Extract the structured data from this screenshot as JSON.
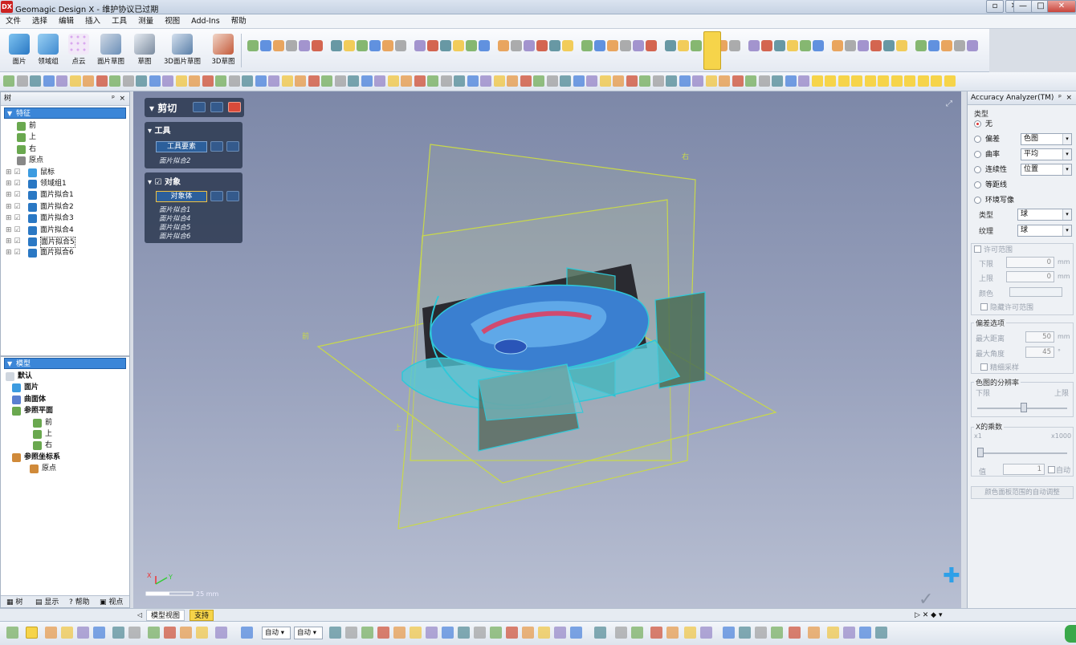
{
  "app": {
    "logo": "DX",
    "title": "Geomagic Design X - 维护协议已过期"
  },
  "window": {
    "minimize": "—",
    "maximize": "□",
    "close": "✕",
    "restore_small": "▫",
    "close_small": "✕"
  },
  "menu": [
    "文件",
    "选择",
    "编辑",
    "插入",
    "工具",
    "测量",
    "视图",
    "Add-Ins",
    "帮助"
  ],
  "ribbon": {
    "buttons": [
      {
        "label": "面片",
        "color": "#3a8fd6"
      },
      {
        "label": "领域组",
        "color": "#4a9ad8"
      },
      {
        "label": "点云",
        "color": "#b27ad0"
      },
      {
        "label": "面片草图",
        "color": "#6b8fb8"
      },
      {
        "label": "草图",
        "color": "#7a8a9e"
      },
      {
        "label": "3D面片草图",
        "color": "#5a7fa8"
      },
      {
        "label": "3D草图",
        "color": "#c45a3a"
      }
    ]
  },
  "tree_panel": {
    "header": "树",
    "pin": "ᵖ",
    "close": "×",
    "section": "特征",
    "items": [
      {
        "label": "前",
        "indent": 1
      },
      {
        "label": "上",
        "indent": 1
      },
      {
        "label": "右",
        "indent": 1
      },
      {
        "label": "原点",
        "indent": 1
      },
      {
        "label": "鼠标",
        "indent": 2
      },
      {
        "label": "领域组1",
        "indent": 2
      },
      {
        "label": "面片拟合1",
        "indent": 2
      },
      {
        "label": "面片拟合2",
        "indent": 2
      },
      {
        "label": "面片拟合3",
        "indent": 2
      },
      {
        "label": "面片拟合4",
        "indent": 2
      },
      {
        "label": "面片拟合5",
        "indent": 2
      },
      {
        "label": "面片拟合6",
        "indent": 2
      }
    ]
  },
  "model_panel": {
    "section": "模型",
    "items": [
      {
        "label": "默认",
        "bold": true
      },
      {
        "label": "面片",
        "bold": true
      },
      {
        "label": "曲面体",
        "bold": true
      },
      {
        "label": "参照平面",
        "bold": true
      },
      {
        "label": "前",
        "bold": false
      },
      {
        "label": "上",
        "bold": false
      },
      {
        "label": "右",
        "bold": false
      },
      {
        "label": "参照坐标系",
        "bold": true
      },
      {
        "label": "原点",
        "bold": false
      }
    ]
  },
  "left_tabs": [
    "树",
    "显示",
    "帮助",
    "视点"
  ],
  "trim_dialog": {
    "title": "剪切",
    "tool_section": "工具",
    "tool_field": "工具要素",
    "tool_items": [
      "面片拟合2"
    ],
    "object_section": "对象",
    "object_field": "对象体",
    "object_items": [
      "面片拟合1",
      "面片拟合4",
      "面片拟合5",
      "面片拟合6"
    ]
  },
  "viewport": {
    "plane_labels": {
      "right": "右",
      "front": "前",
      "top": "上"
    },
    "scale_text": "25 mm",
    "axis_x": "X",
    "axis_y": "Y",
    "colors": {
      "plane": "#c8d84a",
      "surface": "#2fc8d8",
      "mesh": "#3a7fd0",
      "dark": "#2a2a30"
    }
  },
  "bottom_tabs": {
    "model_view": "模型视图",
    "support": "支持"
  },
  "nav_icons": "▷ ✕ ◆ ▾",
  "status": {
    "dropdown1": "自动",
    "dropdown2": "自动"
  },
  "accuracy": {
    "title": "Accuracy Analyzer(TM)",
    "pin": "ᵖ",
    "close": "×",
    "type_group": "类型",
    "radios": [
      {
        "label": "无",
        "on": true
      },
      {
        "label": "偏差",
        "on": false,
        "select": "色图"
      },
      {
        "label": "曲率",
        "on": false,
        "select": "平均"
      },
      {
        "label": "连续性",
        "on": false,
        "select": "位置"
      },
      {
        "label": "等距线",
        "on": false
      },
      {
        "label": "环境写像",
        "on": false
      }
    ],
    "type_label": "类型",
    "type_value": "球",
    "texture_label": "纹理",
    "texture_value": "球",
    "tolerance_group": "许可范围",
    "lower": "下限",
    "upper": "上限",
    "lower_val": "0",
    "upper_val": "0",
    "unit": "mm",
    "color_label": "颜色",
    "hide_tolerance": "隐藏许可范围",
    "deviation_group": "偏差选项",
    "max_distance": "最大距离",
    "max_distance_val": "50",
    "max_angle": "最大角度",
    "max_angle_val": "45",
    "angle_unit": "°",
    "fine_sampling": "精细采样",
    "resolution_group": "色图的分辨率",
    "res_lower": "下限",
    "res_upper": "上限",
    "multiplier_group": "X的乘数",
    "x1": "x1",
    "x1000": "x1000",
    "value_label": "值",
    "value_val": "1",
    "auto": "自动",
    "bottom_button": "颜色面板范围的自动调整"
  }
}
